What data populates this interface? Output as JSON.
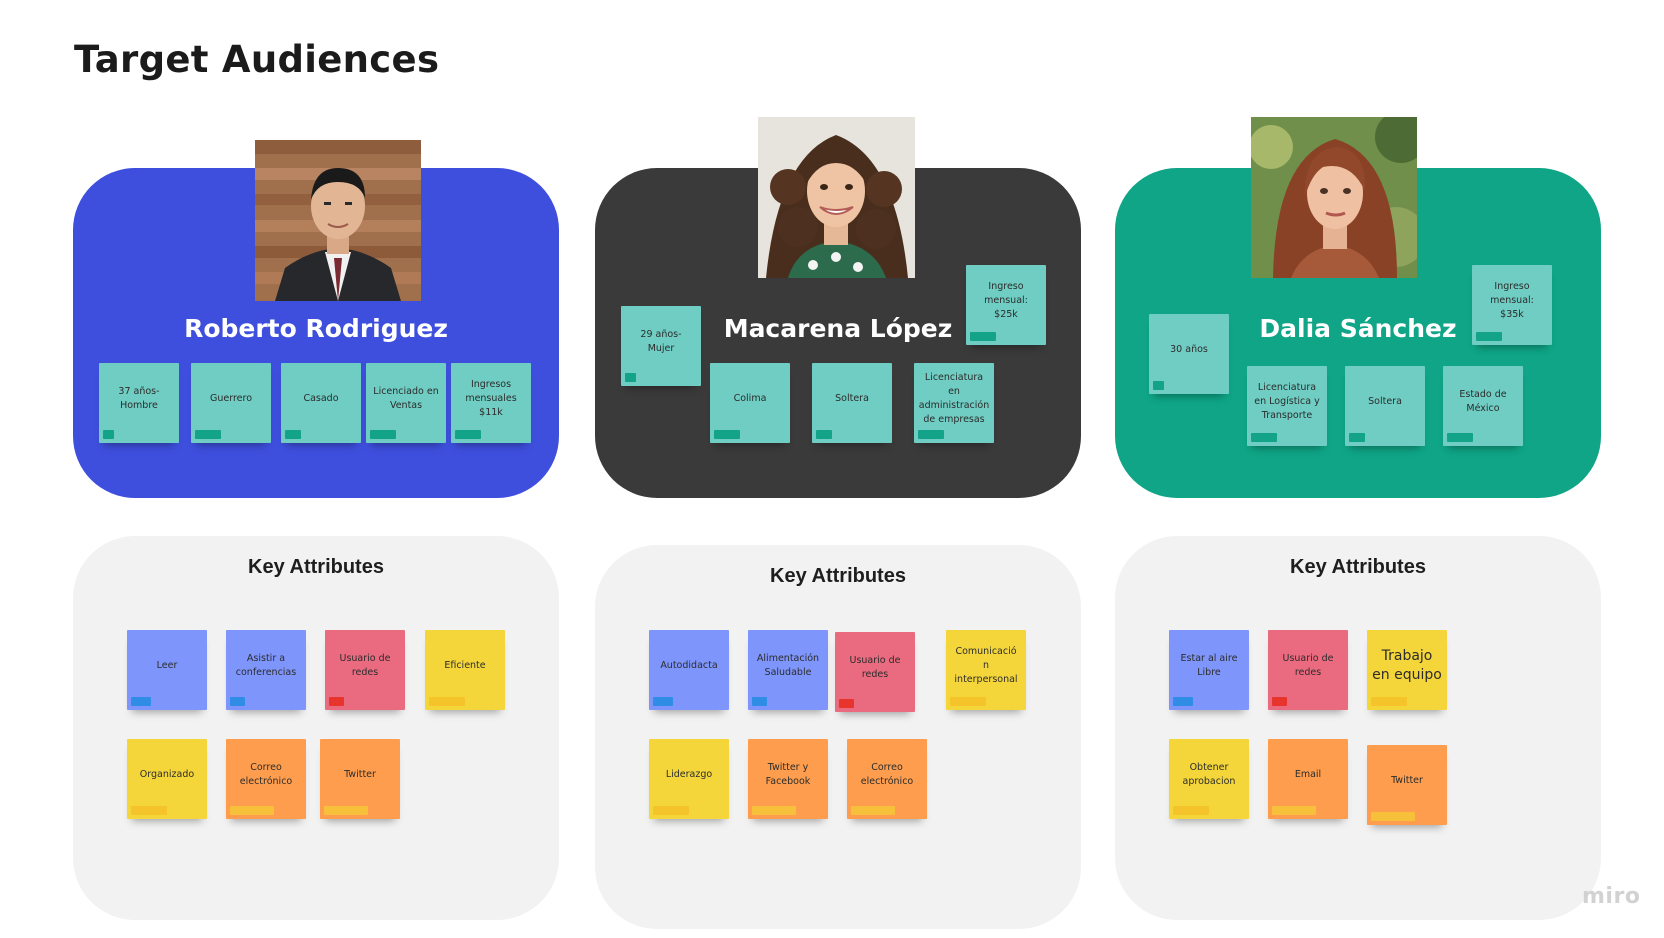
{
  "page": {
    "title": "Target Audiences",
    "logo": "miro"
  },
  "colors": {
    "persona_1_panel": "#3e4fdd",
    "persona_2_panel": "#3a3a3a",
    "persona_3_panel": "#0fa586",
    "attributes_panel": "#f2f2f2",
    "sticky_teal": "#6fcdc3",
    "sticky_blue": "#7e95fb",
    "sticky_red": "#ea6a7f",
    "sticky_yellow": "#f4d63a",
    "sticky_orange": "#fd9d4d"
  },
  "personas": [
    {
      "name": "Roberto Rodriguez",
      "photo_icon": "man-in-suit-photo",
      "notes": [
        "37 años- Hombre",
        "Guerrero",
        "Casado",
        "Licenciado en Ventas",
        "Ingresos mensuales $11k"
      ]
    },
    {
      "name": "Macarena López",
      "photo_icon": "curly-haired-woman-photo",
      "notes": [
        "29 años- Mujer",
        "Ingreso mensual: $25k",
        "Colima",
        "Soltera",
        "Licenciatura en administración de empresas"
      ]
    },
    {
      "name": "Dalia Sánchez",
      "photo_icon": "long-haired-woman-photo",
      "notes": [
        "30 años",
        "Ingreso mensual: $35k",
        "Licenciatura en Logística y Transporte",
        "Soltera",
        "Estado de México"
      ]
    }
  ],
  "attributes": [
    {
      "title": "Key Attributes",
      "notes": [
        "Leer",
        "Asistir a conferencias",
        "Usuario de redes",
        "Eficiente",
        "Organizado",
        "Correo electrónico",
        "Twitter"
      ]
    },
    {
      "title": "Key Attributes",
      "notes": [
        "Autodidacta",
        "Alimentación Saludable",
        "Usuario de redes",
        "Comunicació n interpersonal",
        "Liderazgo",
        "Twitter y Facebook",
        "Correo electrónico"
      ]
    },
    {
      "title": "Key Attributes",
      "notes": [
        "Estar al aire Libre",
        "Usuario de redes",
        "Trabajo en equipo",
        "Obtener aprobacion",
        "Email",
        "Twitter"
      ]
    }
  ]
}
